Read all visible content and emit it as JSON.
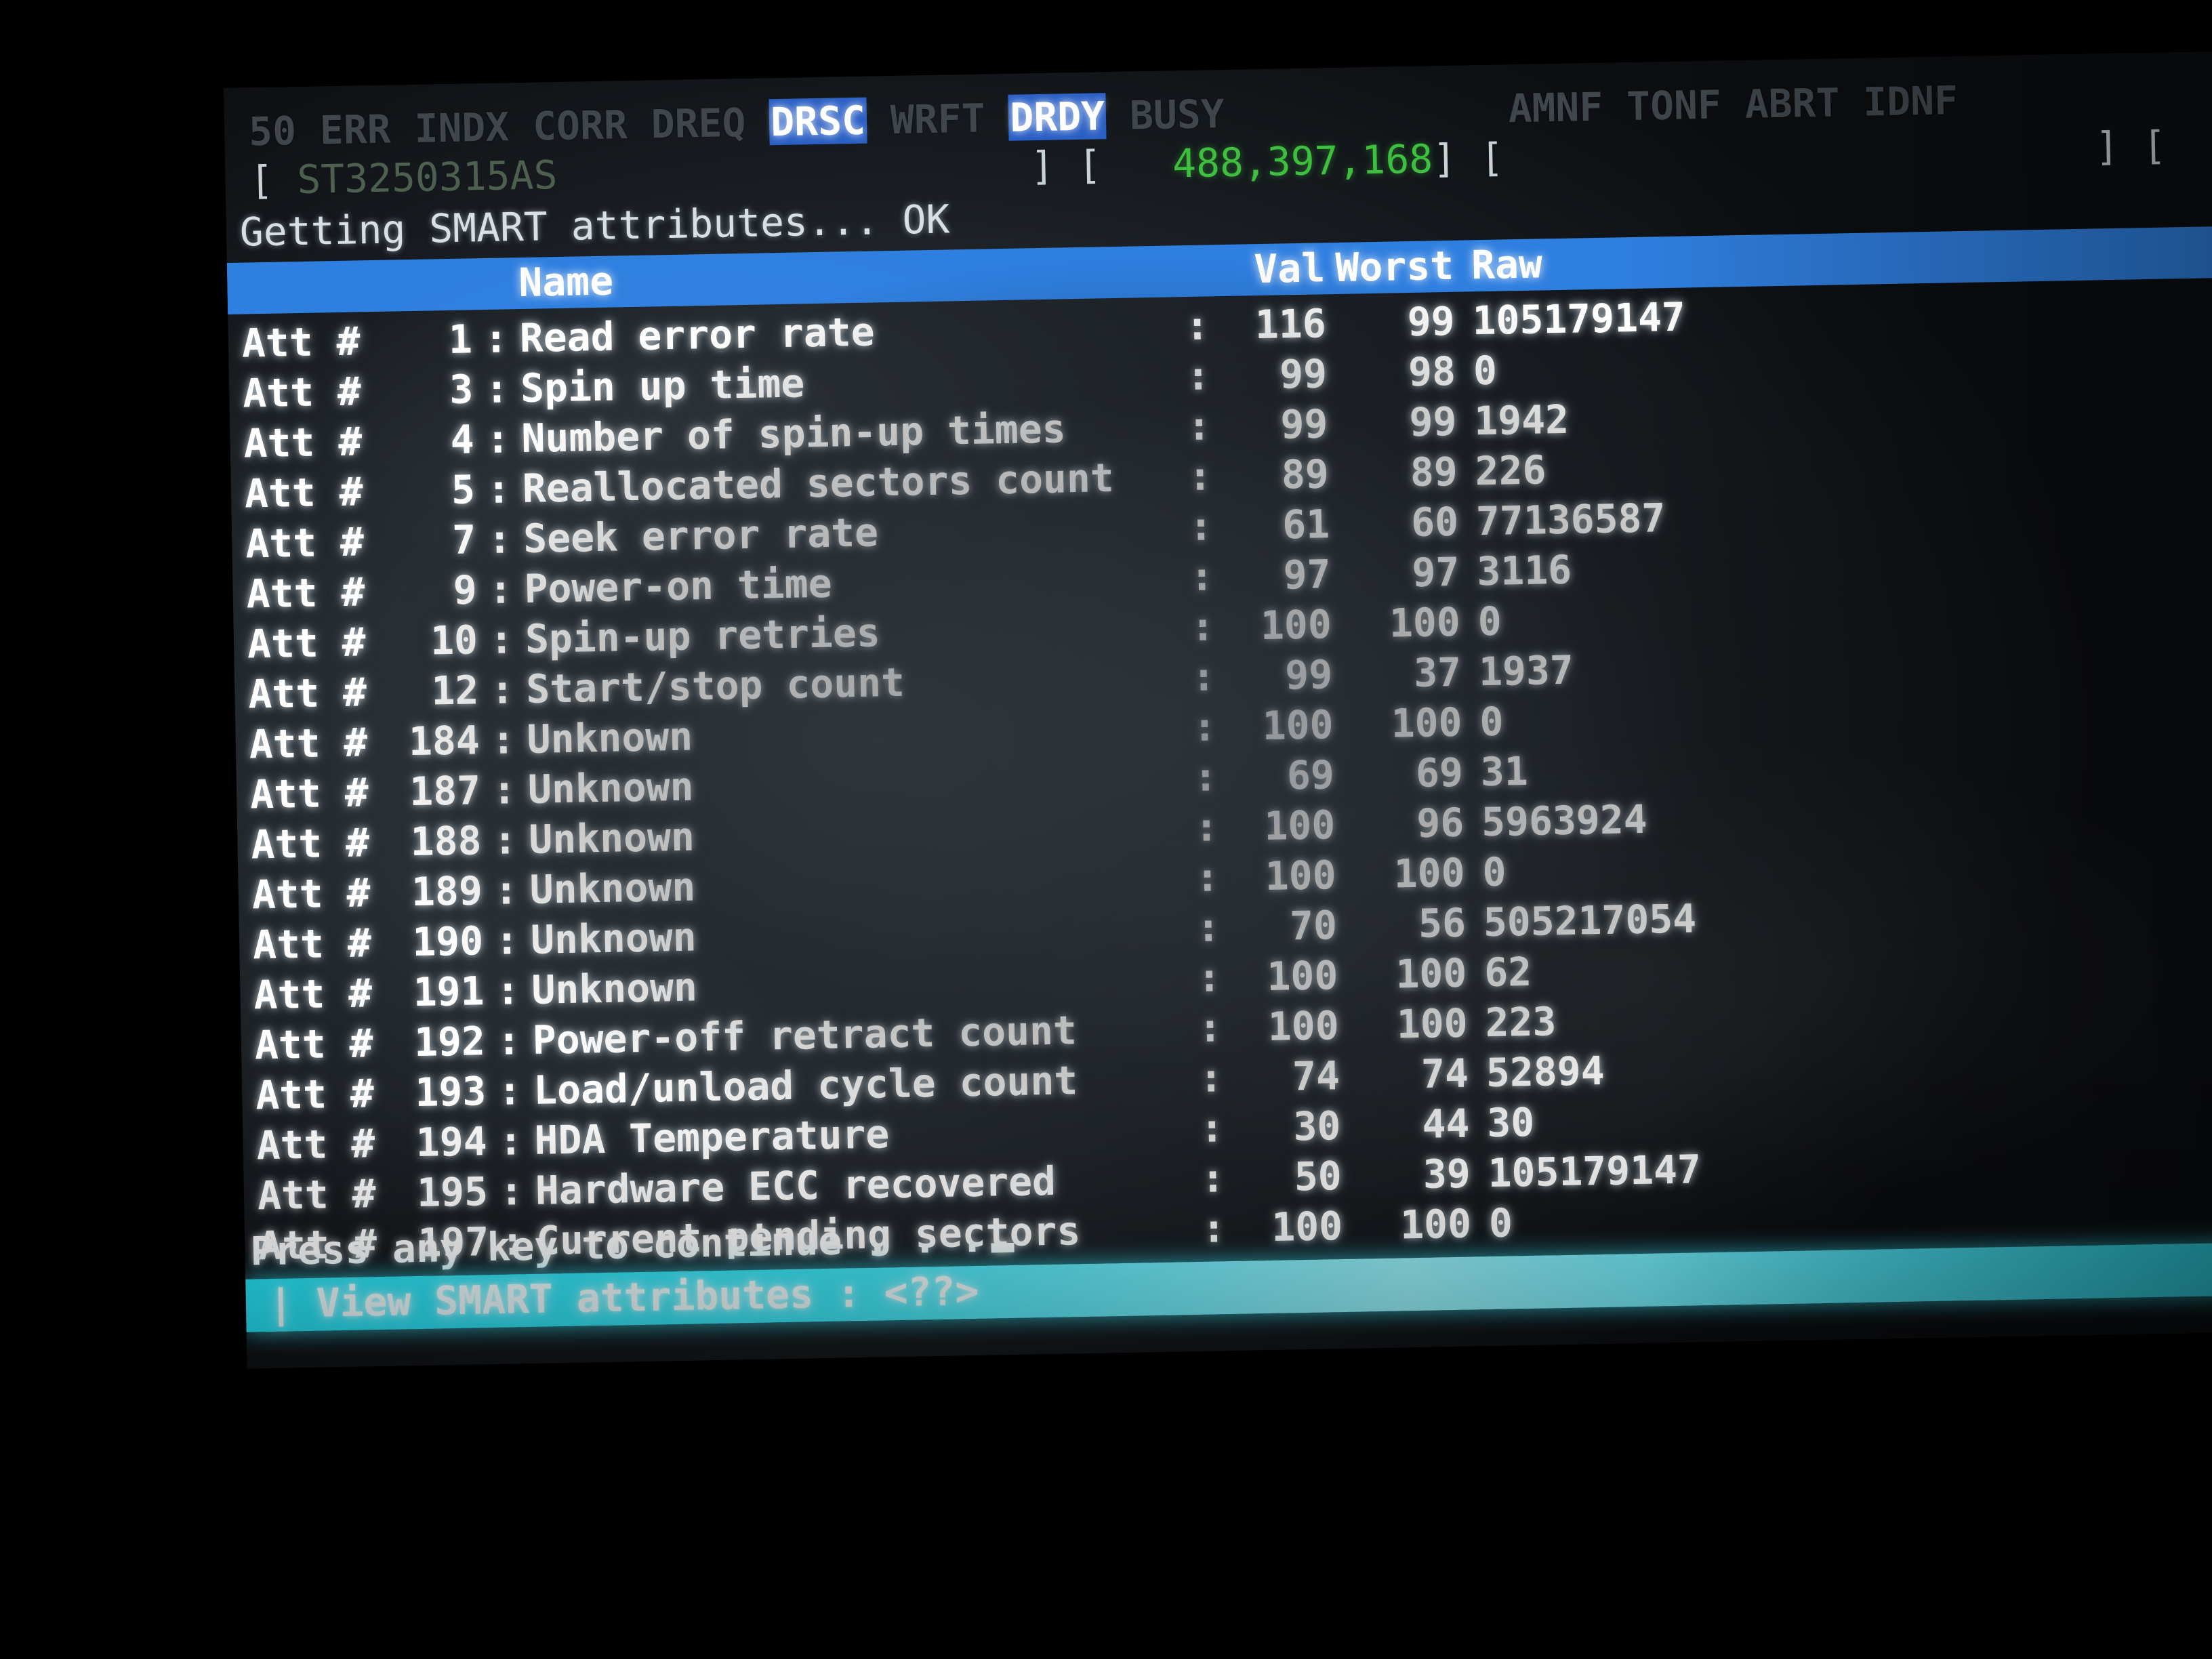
{
  "header": {
    "status_flags_prefix": "50 ERR INDX CORR DREQ ",
    "flag_drsc": "DRSC",
    "status_flags_mid": " WRFT ",
    "flag_drdy": "DRDY",
    "status_flags_suffix": " BUSY            AMNF TONF ABRT IDNF",
    "lba_line_open": "[ ",
    "drive_model": "ST3250315AS",
    "lba_line_mid": "                    ] [   ",
    "lba_count": "488,397,168",
    "lba_line_close": "] [                         ] [",
    "getting_label": "Getting SMART attributes... ",
    "getting_status": "OK"
  },
  "columns": {
    "name": "Name",
    "val": "Val",
    "worst": "Worst",
    "raw": "Raw"
  },
  "table": {
    "att_prefix": "Att #",
    "colon": ":",
    "rows": [
      {
        "id": "1",
        "name": "Read error rate",
        "val": "116",
        "worst": "99",
        "raw": "105179147"
      },
      {
        "id": "3",
        "name": "Spin up time",
        "val": "99",
        "worst": "98",
        "raw": "0"
      },
      {
        "id": "4",
        "name": "Number of spin-up times",
        "val": "99",
        "worst": "99",
        "raw": "1942"
      },
      {
        "id": "5",
        "name": "Reallocated sectors count",
        "val": "89",
        "worst": "89",
        "raw": "226"
      },
      {
        "id": "7",
        "name": "Seek error rate",
        "val": "61",
        "worst": "60",
        "raw": "77136587"
      },
      {
        "id": "9",
        "name": "Power-on time",
        "val": "97",
        "worst": "97",
        "raw": "3116"
      },
      {
        "id": "10",
        "name": "Spin-up retries",
        "val": "100",
        "worst": "100",
        "raw": "0"
      },
      {
        "id": "12",
        "name": "Start/stop count",
        "val": "99",
        "worst": "37",
        "raw": "1937"
      },
      {
        "id": "184",
        "name": "Unknown",
        "val": "100",
        "worst": "100",
        "raw": "0"
      },
      {
        "id": "187",
        "name": "Unknown",
        "val": "69",
        "worst": "69",
        "raw": "31"
      },
      {
        "id": "188",
        "name": "Unknown",
        "val": "100",
        "worst": "96",
        "raw": "5963924"
      },
      {
        "id": "189",
        "name": "Unknown",
        "val": "100",
        "worst": "100",
        "raw": "0"
      },
      {
        "id": "190",
        "name": "Unknown",
        "val": "70",
        "worst": "56",
        "raw": "505217054"
      },
      {
        "id": "191",
        "name": "Unknown",
        "val": "100",
        "worst": "100",
        "raw": "62"
      },
      {
        "id": "192",
        "name": "Power-off retract count",
        "val": "100",
        "worst": "100",
        "raw": "223"
      },
      {
        "id": "193",
        "name": "Load/unload cycle count",
        "val": "74",
        "worst": "74",
        "raw": "52894"
      },
      {
        "id": "194",
        "name": "HDA Temperature",
        "val": "30",
        "worst": "44",
        "raw": "30"
      },
      {
        "id": "195",
        "name": "Hardware ECC recovered",
        "val": "50",
        "worst": "39",
        "raw": "105179147"
      },
      {
        "id": "197",
        "name": "Current pending sectors",
        "val": "100",
        "worst": "100",
        "raw": "0"
      }
    ]
  },
  "prompt": {
    "press_any_key": "Press any key to continue . . ."
  },
  "statusbar": {
    "text": "| View SMART attributes : <??>"
  },
  "colors": {
    "header_bar_blue": "#2f7fe0",
    "status_bar_cyan": "#3fe8f8",
    "highlight_blue": "#2a5fc4",
    "lba_green": "#3fbf3f",
    "text_white": "#ffffff",
    "screen_bg": "#2a3036"
  }
}
